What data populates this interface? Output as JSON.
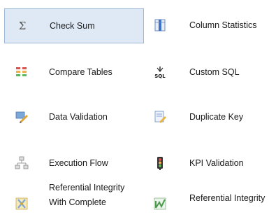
{
  "tiles": [
    {
      "label": "Check Sum",
      "icon": "sigma-icon"
    },
    {
      "label": "Column Statistics",
      "icon": "column-statistics-icon"
    },
    {
      "label": "Compare Tables",
      "icon": "compare-tables-icon"
    },
    {
      "label": "Custom SQL",
      "icon": "custom-sql-icon"
    },
    {
      "label": "Data Validation",
      "icon": "data-validation-icon"
    },
    {
      "label": "Duplicate Key",
      "icon": "duplicate-key-icon"
    },
    {
      "label": "Execution Flow",
      "icon": "execution-flow-icon"
    },
    {
      "label": "KPI Validation",
      "icon": "traffic-light-icon"
    },
    {
      "label_line1": "Referential Integrity",
      "label_line2": "With Complete",
      "icon": "referential-integrity-complete-icon"
    },
    {
      "label": "Referential Integrity",
      "icon": "referential-integrity-icon"
    }
  ],
  "selected_tile": "Check Sum",
  "colors": {
    "selected_background": "#dfe9f6",
    "selected_border": "#9fb8d8"
  }
}
